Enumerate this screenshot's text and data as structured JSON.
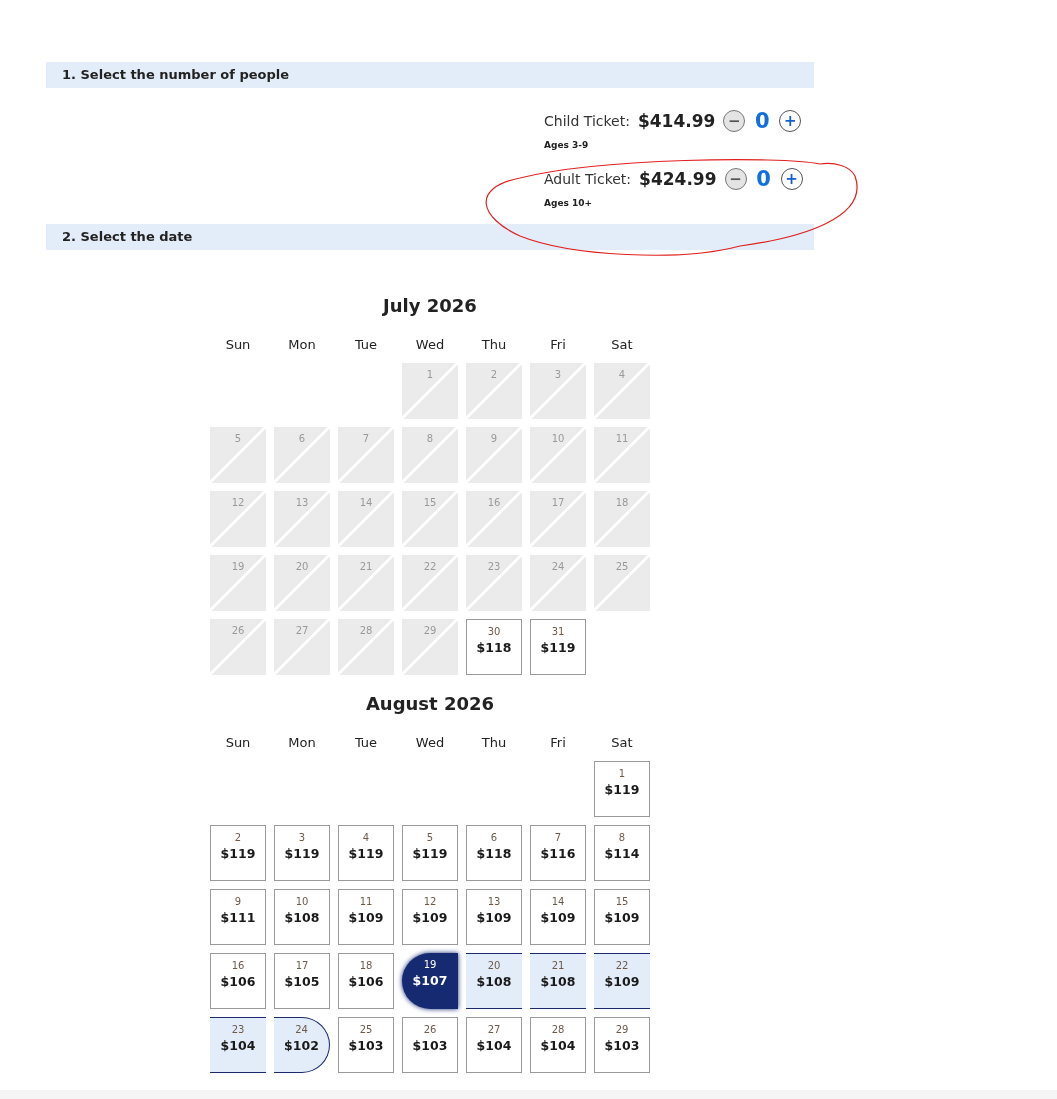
{
  "sections": [
    {
      "title": "1. Select the number of people"
    },
    {
      "title": "2. Select the date"
    }
  ],
  "tickets": [
    {
      "label": "Child Ticket:",
      "price": "$414.99",
      "ages": "Ages 3-9",
      "minus": "−",
      "count": "0",
      "plus": "+",
      "minus_disabled": true
    },
    {
      "label": "Adult Ticket:",
      "price": "$424.99",
      "ages": "Ages 10+",
      "minus": "−",
      "count": "0",
      "plus": "+",
      "minus_disabled": true
    }
  ],
  "months": [
    {
      "title": "July 2026",
      "weekdays": [
        "Sun",
        "Mon",
        "Tue",
        "Wed",
        "Thu",
        "Fri",
        "Sat"
      ],
      "weeks": [
        [
          {
            "kind": "empty"
          },
          {
            "kind": "empty"
          },
          {
            "kind": "empty"
          },
          {
            "kind": "unavailable",
            "day": "1"
          },
          {
            "kind": "unavailable",
            "day": "2"
          },
          {
            "kind": "unavailable",
            "day": "3"
          },
          {
            "kind": "unavailable",
            "day": "4"
          }
        ],
        [
          {
            "kind": "unavailable",
            "day": "5"
          },
          {
            "kind": "unavailable",
            "day": "6"
          },
          {
            "kind": "unavailable",
            "day": "7"
          },
          {
            "kind": "unavailable",
            "day": "8"
          },
          {
            "kind": "unavailable",
            "day": "9"
          },
          {
            "kind": "unavailable",
            "day": "10"
          },
          {
            "kind": "unavailable",
            "day": "11"
          }
        ],
        [
          {
            "kind": "unavailable",
            "day": "12"
          },
          {
            "kind": "unavailable",
            "day": "13"
          },
          {
            "kind": "unavailable",
            "day": "14"
          },
          {
            "kind": "unavailable",
            "day": "15"
          },
          {
            "kind": "unavailable",
            "day": "16"
          },
          {
            "kind": "unavailable",
            "day": "17"
          },
          {
            "kind": "unavailable",
            "day": "18"
          }
        ],
        [
          {
            "kind": "unavailable",
            "day": "19"
          },
          {
            "kind": "unavailable",
            "day": "20"
          },
          {
            "kind": "unavailable",
            "day": "21"
          },
          {
            "kind": "unavailable",
            "day": "22"
          },
          {
            "kind": "unavailable",
            "day": "23"
          },
          {
            "kind": "unavailable",
            "day": "24"
          },
          {
            "kind": "unavailable",
            "day": "25"
          }
        ],
        [
          {
            "kind": "unavailable",
            "day": "26"
          },
          {
            "kind": "unavailable",
            "day": "27"
          },
          {
            "kind": "unavailable",
            "day": "28"
          },
          {
            "kind": "unavailable",
            "day": "29"
          },
          {
            "kind": "available",
            "day": "30",
            "price": "$118"
          },
          {
            "kind": "available",
            "day": "31",
            "price": "$119"
          },
          {
            "kind": "empty"
          }
        ]
      ]
    },
    {
      "title": "August 2026",
      "weekdays": [
        "Sun",
        "Mon",
        "Tue",
        "Wed",
        "Thu",
        "Fri",
        "Sat"
      ],
      "weeks": [
        [
          {
            "kind": "empty"
          },
          {
            "kind": "empty"
          },
          {
            "kind": "empty"
          },
          {
            "kind": "empty"
          },
          {
            "kind": "empty"
          },
          {
            "kind": "empty"
          },
          {
            "kind": "available",
            "day": "1",
            "price": "$119"
          }
        ],
        [
          {
            "kind": "available",
            "day": "2",
            "price": "$119"
          },
          {
            "kind": "available",
            "day": "3",
            "price": "$119"
          },
          {
            "kind": "available",
            "day": "4",
            "price": "$119"
          },
          {
            "kind": "available",
            "day": "5",
            "price": "$119"
          },
          {
            "kind": "available",
            "day": "6",
            "price": "$118"
          },
          {
            "kind": "available",
            "day": "7",
            "price": "$116"
          },
          {
            "kind": "available",
            "day": "8",
            "price": "$114"
          }
        ],
        [
          {
            "kind": "available",
            "day": "9",
            "price": "$111"
          },
          {
            "kind": "available",
            "day": "10",
            "price": "$108"
          },
          {
            "kind": "available",
            "day": "11",
            "price": "$109"
          },
          {
            "kind": "available",
            "day": "12",
            "price": "$109"
          },
          {
            "kind": "available",
            "day": "13",
            "price": "$109"
          },
          {
            "kind": "available",
            "day": "14",
            "price": "$109"
          },
          {
            "kind": "available",
            "day": "15",
            "price": "$109"
          }
        ],
        [
          {
            "kind": "available",
            "day": "16",
            "price": "$106"
          },
          {
            "kind": "available",
            "day": "17",
            "price": "$105"
          },
          {
            "kind": "available",
            "day": "18",
            "price": "$106"
          },
          {
            "kind": "range_start",
            "day": "19",
            "price": "$107"
          },
          {
            "kind": "in_range",
            "day": "20",
            "price": "$108"
          },
          {
            "kind": "in_range",
            "day": "21",
            "price": "$108"
          },
          {
            "kind": "in_range",
            "day": "22",
            "price": "$109"
          }
        ],
        [
          {
            "kind": "in_range",
            "day": "23",
            "price": "$104"
          },
          {
            "kind": "range_end",
            "day": "24",
            "price": "$102"
          },
          {
            "kind": "available",
            "day": "25",
            "price": "$103"
          },
          {
            "kind": "available",
            "day": "26",
            "price": "$103"
          },
          {
            "kind": "available",
            "day": "27",
            "price": "$104"
          },
          {
            "kind": "available",
            "day": "28",
            "price": "$104"
          },
          {
            "kind": "available",
            "day": "29",
            "price": "$103"
          }
        ]
      ]
    }
  ]
}
